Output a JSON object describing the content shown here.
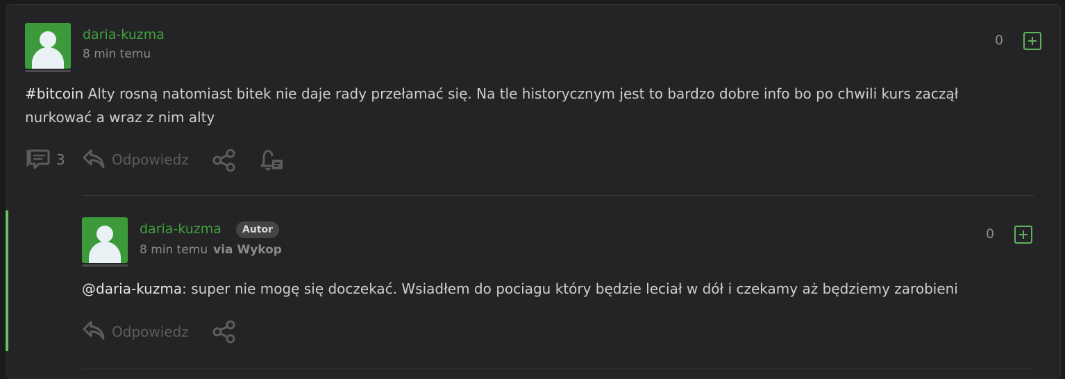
{
  "post": {
    "username": "daria-kuzma",
    "time": "8 min temu",
    "votes": "0",
    "tag": "#bitcoin",
    "content_line1": " Alty rosną natomiast bitek nie daje rady przełamać się. Na tle historycznym jest to bardzo dobre info bo po chwili kurs zaczął",
    "content_line2": "nurkować a wraz z nim alty",
    "comments_count": "3",
    "reply_label": "Odpowiedz"
  },
  "reply": {
    "username": "daria-kuzma",
    "badge": "Autor",
    "time": "8 min temu",
    "via": "via Wykop",
    "votes": "0",
    "mention": "@daria-kuzma",
    "content": ": super nie mogę się doczekać. Wsiadłem do pociagu który będzie leciał w dół i czekamy aż będziemy zarobieni",
    "reply_label": "Odpowiedz"
  },
  "icons": {
    "comments": "comments-icon",
    "reply": "reply-arrow-icon",
    "share": "share-icon",
    "notify": "bell-icon",
    "plus": "plus-vote-icon"
  },
  "colors": {
    "accent": "#3fa23c",
    "background": "#242426",
    "thread_line": "#6ac464"
  }
}
